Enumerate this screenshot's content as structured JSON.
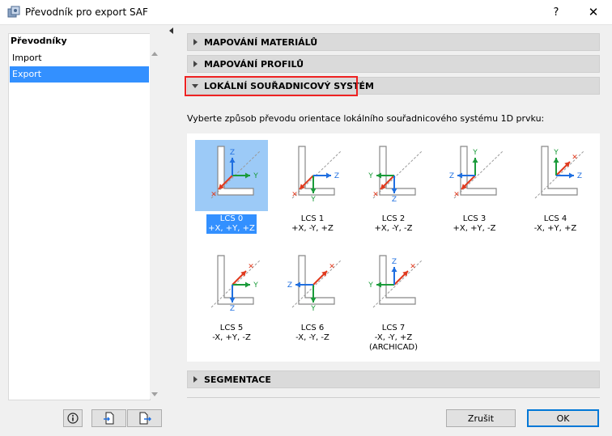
{
  "window": {
    "title": "Převodník pro export SAF",
    "help_glyph": "?",
    "close_glyph": "✕"
  },
  "sidebar": {
    "header": "Převodníky",
    "items": [
      {
        "label": "Import",
        "selected": false
      },
      {
        "label": "Export",
        "selected": true
      }
    ]
  },
  "sections": {
    "materials": "MAPOVÁNÍ MATERIÁLŮ",
    "profiles": "MAPOVÁNÍ PROFILŮ",
    "lcs": "LOKÁLNÍ SOUŘADNICOVÝ SYSTÉM",
    "segmentation": "SEGMENTACE"
  },
  "instruction": "Vyberte způsob převodu orientace lokálního souřadnicového systému 1D prvku:",
  "lcs_options": [
    {
      "name": "LCS 0",
      "axes": "+X, +Y, +Z",
      "note": "",
      "selected": true
    },
    {
      "name": "LCS 1",
      "axes": "+X, -Y, +Z",
      "note": "",
      "selected": false
    },
    {
      "name": "LCS 2",
      "axes": "+X, -Y, -Z",
      "note": "",
      "selected": false
    },
    {
      "name": "LCS 3",
      "axes": "+X, +Y, -Z",
      "note": "",
      "selected": false
    },
    {
      "name": "LCS 4",
      "axes": "-X, +Y, +Z",
      "note": "",
      "selected": false
    },
    {
      "name": "LCS 5",
      "axes": "-X, +Y, -Z",
      "note": "",
      "selected": false
    },
    {
      "name": "LCS 6",
      "axes": "-X, -Y, -Z",
      "note": "",
      "selected": false
    },
    {
      "name": "LCS 7",
      "axes": "-X, -Y, +Z",
      "note": "(ARCHICAD)",
      "selected": false
    }
  ],
  "buttons": {
    "cancel": "Zrušit",
    "ok": "OK",
    "info_icon": "info-icon",
    "import_icon": "import-file-icon",
    "export_icon": "export-file-icon"
  },
  "colors": {
    "selection": "#3390ff",
    "highlight_border": "#e22222",
    "axis_x": "#e03a1e",
    "axis_y": "#1a9b3a",
    "axis_z": "#1f6fe0"
  }
}
